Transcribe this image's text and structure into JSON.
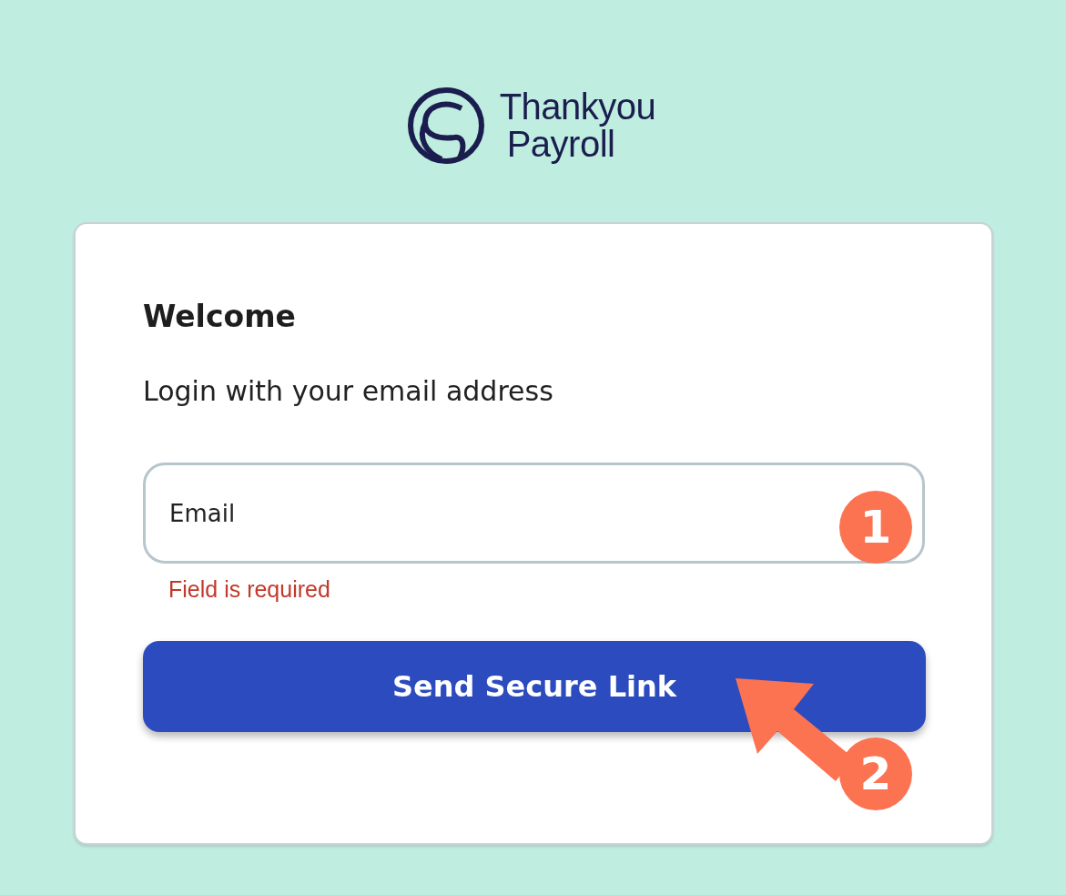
{
  "logo": {
    "line_1": "Thankyou",
    "line_2": "Payroll"
  },
  "card": {
    "title": "Welcome",
    "subtitle": "Login with your email address",
    "email_field": {
      "placeholder": "Email",
      "error": "Field is required"
    },
    "submit_button": {
      "label": "Send Secure Link"
    }
  },
  "annotations": [
    {
      "label": "1",
      "kind": "badge"
    },
    {
      "label": "2",
      "kind": "arrow-badge"
    }
  ]
}
